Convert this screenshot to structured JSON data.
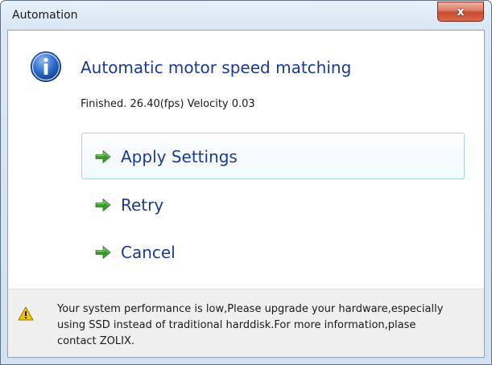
{
  "window": {
    "title": "Automation",
    "close_glyph": "x"
  },
  "dialog": {
    "main_instruction": "Automatic motor speed matching",
    "content": "Finished. 26.40(fps) Velocity 0.03",
    "icon": "info-icon",
    "commands": [
      {
        "label": "Apply Settings",
        "icon": "green-arrow-icon",
        "highlighted": true
      },
      {
        "label": "Retry",
        "icon": "green-arrow-icon",
        "highlighted": false
      },
      {
        "label": "Cancel",
        "icon": "green-arrow-icon",
        "highlighted": false
      }
    ]
  },
  "footer": {
    "icon": "warning-icon",
    "text": "Your system performance is low,Please upgrade your hardware,especially using SSD instead of traditional harddisk.For more information,plase contact ZOLIX."
  },
  "colors": {
    "accent_text": "#1b3a8f",
    "arrow_green": "#3a9a2e",
    "close_red": "#c74b30",
    "warning_yellow": "#f2c200"
  }
}
